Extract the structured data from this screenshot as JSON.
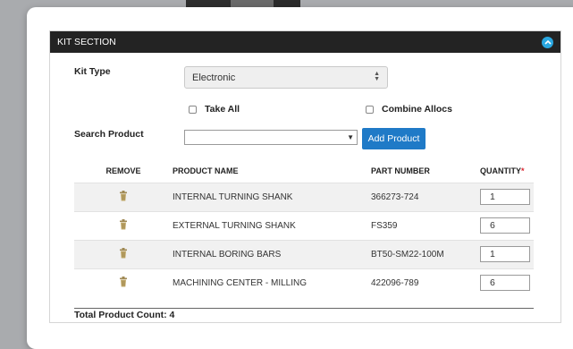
{
  "panel": {
    "title": "KIT SECTION"
  },
  "kit_type": {
    "label": "Kit Type",
    "value": "Electronic"
  },
  "options": {
    "take_all": "Take All",
    "combine_allocs": "Combine Allocs"
  },
  "search": {
    "label": "Search Product",
    "value": "",
    "add_button": "Add Product"
  },
  "table": {
    "headers": {
      "remove": "REMOVE",
      "name": "PRODUCT NAME",
      "part": "PART NUMBER",
      "quantity": "QUANTITY",
      "required_marker": "*"
    },
    "rows": [
      {
        "name": "INTERNAL TURNING SHANK",
        "part": "366273-724",
        "quantity": "1"
      },
      {
        "name": "EXTERNAL TURNING SHANK",
        "part": "FS359",
        "quantity": "6"
      },
      {
        "name": "INTERNAL BORING BARS",
        "part": "BT50-SM22-100M",
        "quantity": "1"
      },
      {
        "name": "MACHINING CENTER - MILLING",
        "part": "422096-789",
        "quantity": "6"
      }
    ]
  },
  "footer": {
    "total_label": "Total Product Count: 4"
  },
  "colors": {
    "header_bg": "#232323",
    "accent": "#2aa7e0",
    "button": "#1f7ac7",
    "required": "#d9232e"
  },
  "icons": {
    "collapse": "chevron-up-icon",
    "remove": "trash-icon"
  }
}
